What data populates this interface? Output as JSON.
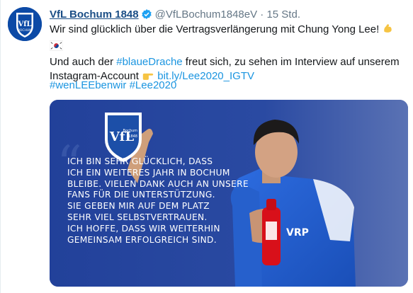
{
  "account": {
    "display_name": "VfL Bochum 1848",
    "handle": "@VfLBochum1848eV",
    "separator": "·",
    "time": "15 Std.",
    "avatar_logo": "VfL Bochum 1848 crest"
  },
  "tweet": {
    "line1_text": "Wir sind glücklich über die Vertragsverlängerung mit Chung Yong Lee!",
    "line1_emojis": [
      "flexed-biceps-emoji",
      "south-korea-flag-emoji"
    ],
    "line2_prefix": "Und auch der ",
    "line2_hashtag": "#blaueDrache",
    "line2_suffix": " freut sich, zu sehen im Interview auf unserem",
    "line3_prefix": "Instagram-Account ",
    "line3_emoji": "pointing-right-emoji",
    "line3_link": "bit.ly/Lee2020_IGTV",
    "hashtags": [
      "#wenLEEbenwir",
      "#Lee2020"
    ]
  },
  "media": {
    "crest_text_1": "VfL",
    "crest_text_2": "Bochum",
    "crest_text_3": "1848",
    "quote_lines": [
      "Ich bin sehr glücklich, dass",
      "ich ein weiteres Jahr in Bochum",
      "bleibe. Vielen Dank auch an unsere",
      "Fans für die Unterstützung.",
      "Sie geben mir auf dem Platz",
      "sehr viel Selbstvertrauen.",
      "Ich hoffe, dass wir weiterhin",
      "gemeinsam erfolgreich sind."
    ],
    "jersey_text": "VRP"
  },
  "colors": {
    "name_blue": "#1b4e86",
    "link_blue": "#1b95e0",
    "media_bg": "#24479a",
    "jersey_blue": "#1f5cc8"
  }
}
